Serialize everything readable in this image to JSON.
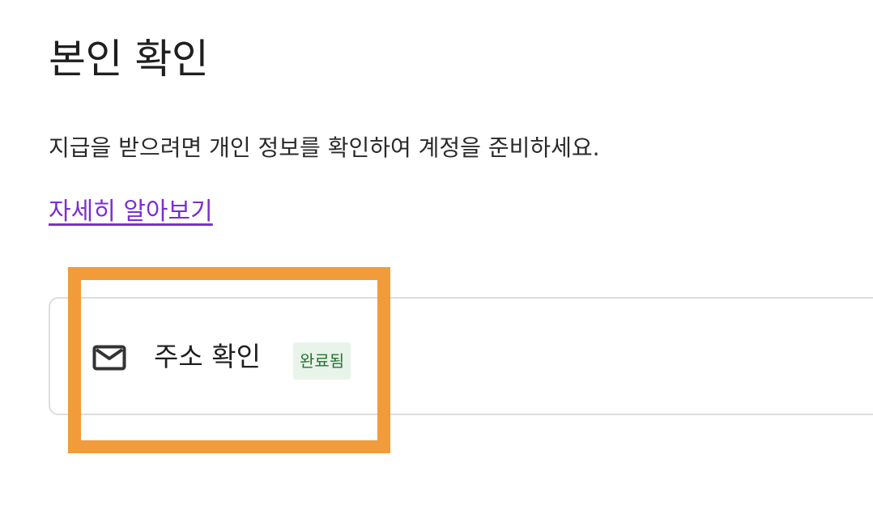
{
  "page": {
    "title": "본인 확인",
    "description": "지급을 받으려면 개인 정보를 확인하여 계정을 준비하세요.",
    "learn_more_label": "자세히 알아보기"
  },
  "verification_card": {
    "icon": "envelope-icon",
    "label": "주소 확인",
    "status": "완료됨"
  },
  "colors": {
    "link": "#7b2fd1",
    "badge_background": "#e8f3ea",
    "badge_text": "#23762f",
    "highlight": "#f19b3a"
  }
}
